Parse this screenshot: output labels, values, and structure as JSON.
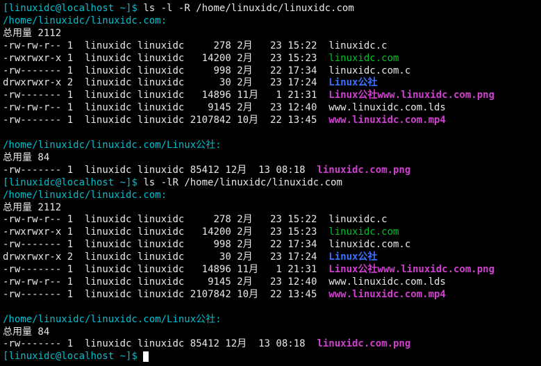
{
  "prompt": {
    "user": "linuxidc",
    "host": "localhost",
    "dir": "~",
    "open": "[",
    "close": "]$"
  },
  "commands": {
    "cmd1": "ls -l -R /home/linuxidc/linuxidc.com",
    "cmd2": "ls -lR /home/linuxidc/linuxidc.com"
  },
  "block1": {
    "header": "/home/linuxidc/linuxidc.com:",
    "total": "总用量 2112",
    "rows": [
      {
        "perm": "-rw-rw-r--",
        "link": "1",
        "owner": "linuxidc",
        "group": "linuxidc",
        "size": "278",
        "month": "2月",
        "day": "23",
        "time": "15:22",
        "name": "linuxidc.c",
        "cls": "white"
      },
      {
        "perm": "-rwxrwxr-x",
        "link": "1",
        "owner": "linuxidc",
        "group": "linuxidc",
        "size": "14200",
        "month": "2月",
        "day": "23",
        "time": "15:23",
        "name": "linuxidc.com",
        "cls": "green"
      },
      {
        "perm": "-rw-------",
        "link": "1",
        "owner": "linuxidc",
        "group": "linuxidc",
        "size": "998",
        "month": "2月",
        "day": "22",
        "time": "17:34",
        "name": "linuxidc.com.c",
        "cls": "white"
      },
      {
        "perm": "drwxrwxr-x",
        "link": "2",
        "owner": "linuxidc",
        "group": "linuxidc",
        "size": "30",
        "month": "2月",
        "day": "23",
        "time": "17:24",
        "name": "Linux公社",
        "cls": "blue"
      },
      {
        "perm": "-rw-------",
        "link": "1",
        "owner": "linuxidc",
        "group": "linuxidc",
        "size": "14896",
        "month": "11月",
        "day": "1",
        "time": "21:31",
        "name": "Linux公社www.linuxidc.com.png",
        "cls": "magenta"
      },
      {
        "perm": "-rw-rw-r--",
        "link": "1",
        "owner": "linuxidc",
        "group": "linuxidc",
        "size": "9145",
        "month": "2月",
        "day": "23",
        "time": "12:40",
        "name": "www.linuxidc.com.lds",
        "cls": "white"
      },
      {
        "perm": "-rw-------",
        "link": "1",
        "owner": "linuxidc",
        "group": "linuxidc",
        "size": "2107842",
        "month": "10月",
        "day": "22",
        "time": "13:45",
        "name": "www.linuxidc.com.mp4",
        "cls": "magenta"
      }
    ]
  },
  "block2": {
    "header": "/home/linuxidc/linuxidc.com/Linux公社:",
    "total": "总用量 84",
    "rows": [
      {
        "perm": "-rw-------",
        "link": "1",
        "owner": "linuxidc",
        "group": "linuxidc",
        "size": "85412",
        "month": "12月",
        "day": "13",
        "time": "08:18",
        "name": "linuxidc.com.png",
        "cls": "magenta"
      }
    ]
  }
}
